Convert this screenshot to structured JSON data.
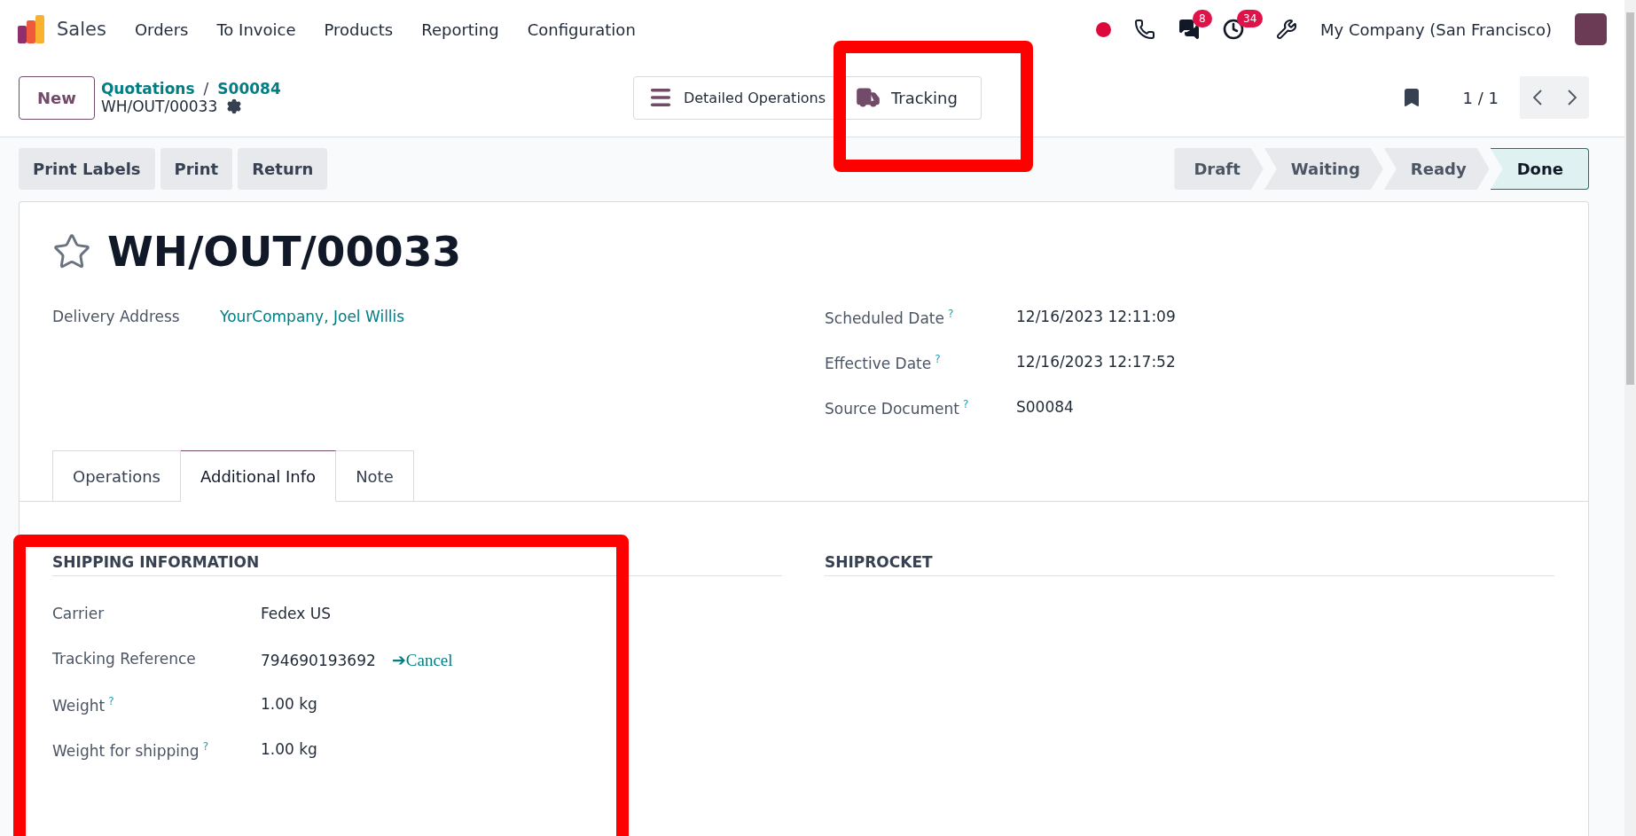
{
  "navbar": {
    "app_name": "Sales",
    "menu": [
      "Orders",
      "To Invoice",
      "Products",
      "Reporting",
      "Configuration"
    ],
    "messages_badge": "8",
    "activities_badge": "34",
    "company": "My Company (San Francisco)"
  },
  "control_panel": {
    "new_button": "New",
    "breadcrumb": [
      "Quotations",
      "S00084"
    ],
    "separator": "/",
    "record": "WH/OUT/00033",
    "smart_buttons": [
      {
        "kind": "list",
        "label": "Detailed Operations"
      },
      {
        "kind": "truck",
        "label": "Tracking"
      }
    ],
    "pager": "1 / 1"
  },
  "actions": [
    "Print Labels",
    "Print",
    "Return"
  ],
  "statusbar": [
    {
      "label": "Draft",
      "selected": false
    },
    {
      "label": "Waiting",
      "selected": false
    },
    {
      "label": "Ready",
      "selected": false
    },
    {
      "label": "Done",
      "selected": true
    }
  ],
  "form": {
    "title": "WH/OUT/00033",
    "starred": false,
    "left_fields": [
      {
        "label": "Delivery Address",
        "value": "YourCompany, Joel Willis",
        "kind": "link"
      }
    ],
    "right_fields": [
      {
        "label": "Scheduled Date",
        "help": "?",
        "value": "12/16/2023 12:11:09"
      },
      {
        "label": "Effective Date",
        "help": "?",
        "value": "12/16/2023 12:17:52"
      },
      {
        "label": "Source Document",
        "help": "?",
        "value": "S00084"
      }
    ],
    "tabs": [
      {
        "label": "Operations",
        "selected": false
      },
      {
        "label": "Additional Info",
        "selected": true
      },
      {
        "label": "Note",
        "selected": false
      }
    ],
    "sections": [
      {
        "title": "SHIPPING INFORMATION",
        "fields": [
          {
            "label": "Carrier",
            "value": "Fedex US"
          },
          {
            "label": "Tracking Reference",
            "value": "794690193692",
            "link": "➔Cancel"
          },
          {
            "label": "Weight",
            "help": "?",
            "value": "1.00 kg"
          },
          {
            "label": "Weight for shipping",
            "help": "?",
            "value": "1.00 kg"
          }
        ]
      },
      {
        "title": "SHIPROCKET"
      }
    ]
  },
  "annotation_frames": [
    {
      "kind": "rectangle"
    },
    {
      "kind": "rectangle"
    }
  ]
}
